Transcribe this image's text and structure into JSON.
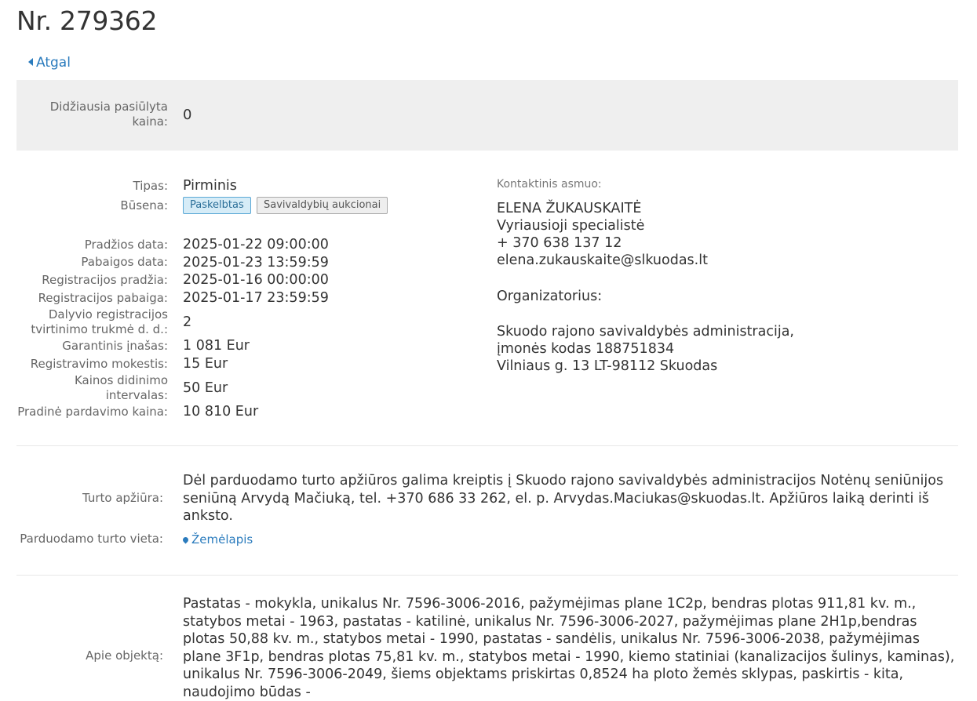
{
  "header": {
    "title": "Nr. 279362",
    "back_label": "Atgal"
  },
  "bid": {
    "label": "Didžiausia pasiūlyta kaina:",
    "value": "0"
  },
  "details": {
    "type_label": "Tipas:",
    "type_value": "Pirminis",
    "status_label": "Būsena:",
    "status_badges": [
      "Paskelbtas",
      "Savivaldybių aukcionai"
    ],
    "rows": [
      {
        "label": "Pradžios data:",
        "value": "2025-01-22 09:00:00"
      },
      {
        "label": "Pabaigos data:",
        "value": "2025-01-23 13:59:59"
      },
      {
        "label": "Registracijos pradžia:",
        "value": "2025-01-16 00:00:00"
      },
      {
        "label": "Registracijos pabaiga:",
        "value": "2025-01-17 23:59:59"
      },
      {
        "label": "Dalyvio registracijos tvirtinimo trukmė d. d.:",
        "value": "2"
      },
      {
        "label": "Garantinis įnašas:",
        "value": "1 081 Eur"
      },
      {
        "label": "Registravimo mokestis:",
        "value": "15 Eur"
      },
      {
        "label": "Kainos didinimo intervalas:",
        "value": "50 Eur"
      },
      {
        "label": "Pradinė pardavimo kaina:",
        "value": "10 810 Eur"
      }
    ]
  },
  "contact": {
    "label": "Kontaktinis asmuo:",
    "name": "ELENA ŽUKAUSKAITĖ",
    "position": "Vyriausioji specialistė",
    "phone": "+ 370 638 137 12",
    "email": "elena.zukauskaite@slkuodas.lt",
    "organizer_label": "Organizatorius:",
    "org_name": "Skuodo rajono savivaldybės administracija,",
    "org_code": "įmonės kodas 188751834",
    "org_address": "Vilniaus g. 13 LT-98112 Skuodas"
  },
  "inspection": {
    "label": "Turto apžiūra:",
    "text": "Dėl parduodamo turto apžiūros galima kreiptis į Skuodo rajono savivaldybės administracijos Notėnų seniūnijos seniūną Arvydą Mačiuką, tel. +370 686 33 262, el. p. Arvydas.Maciukas@skuodas.lt. Apžiūros laiką derinti iš anksto."
  },
  "location": {
    "label": "Parduodamo turto vieta:",
    "link": "Žemėlapis"
  },
  "about": {
    "label": "Apie objektą:",
    "text": "Pastatas - mokykla, unikalus Nr. 7596-3006-2016, pažymėjimas plane 1C2p, bendras plotas 911,81 kv. m., statybos metai - 1963, pastatas - katilinė, unikalus Nr. 7596-3006-2027, pažymėjimas plane 2H1p,bendras plotas 50,88 kv. m., statybos metai - 1990, pastatas - sandėlis, unikalus Nr. 7596-3006-2038, pažymėjimas plane 3F1p, bendras plotas 75,81 kv. m., statybos metai - 1990, kiemo statiniai (kanalizacijos šulinys, kaminas), unikalus Nr. 7596-3006-2049, šiems objektams priskirtas 0,8524 ha ploto žemės sklypas, paskirtis - kita, naudojimo būdas -"
  }
}
